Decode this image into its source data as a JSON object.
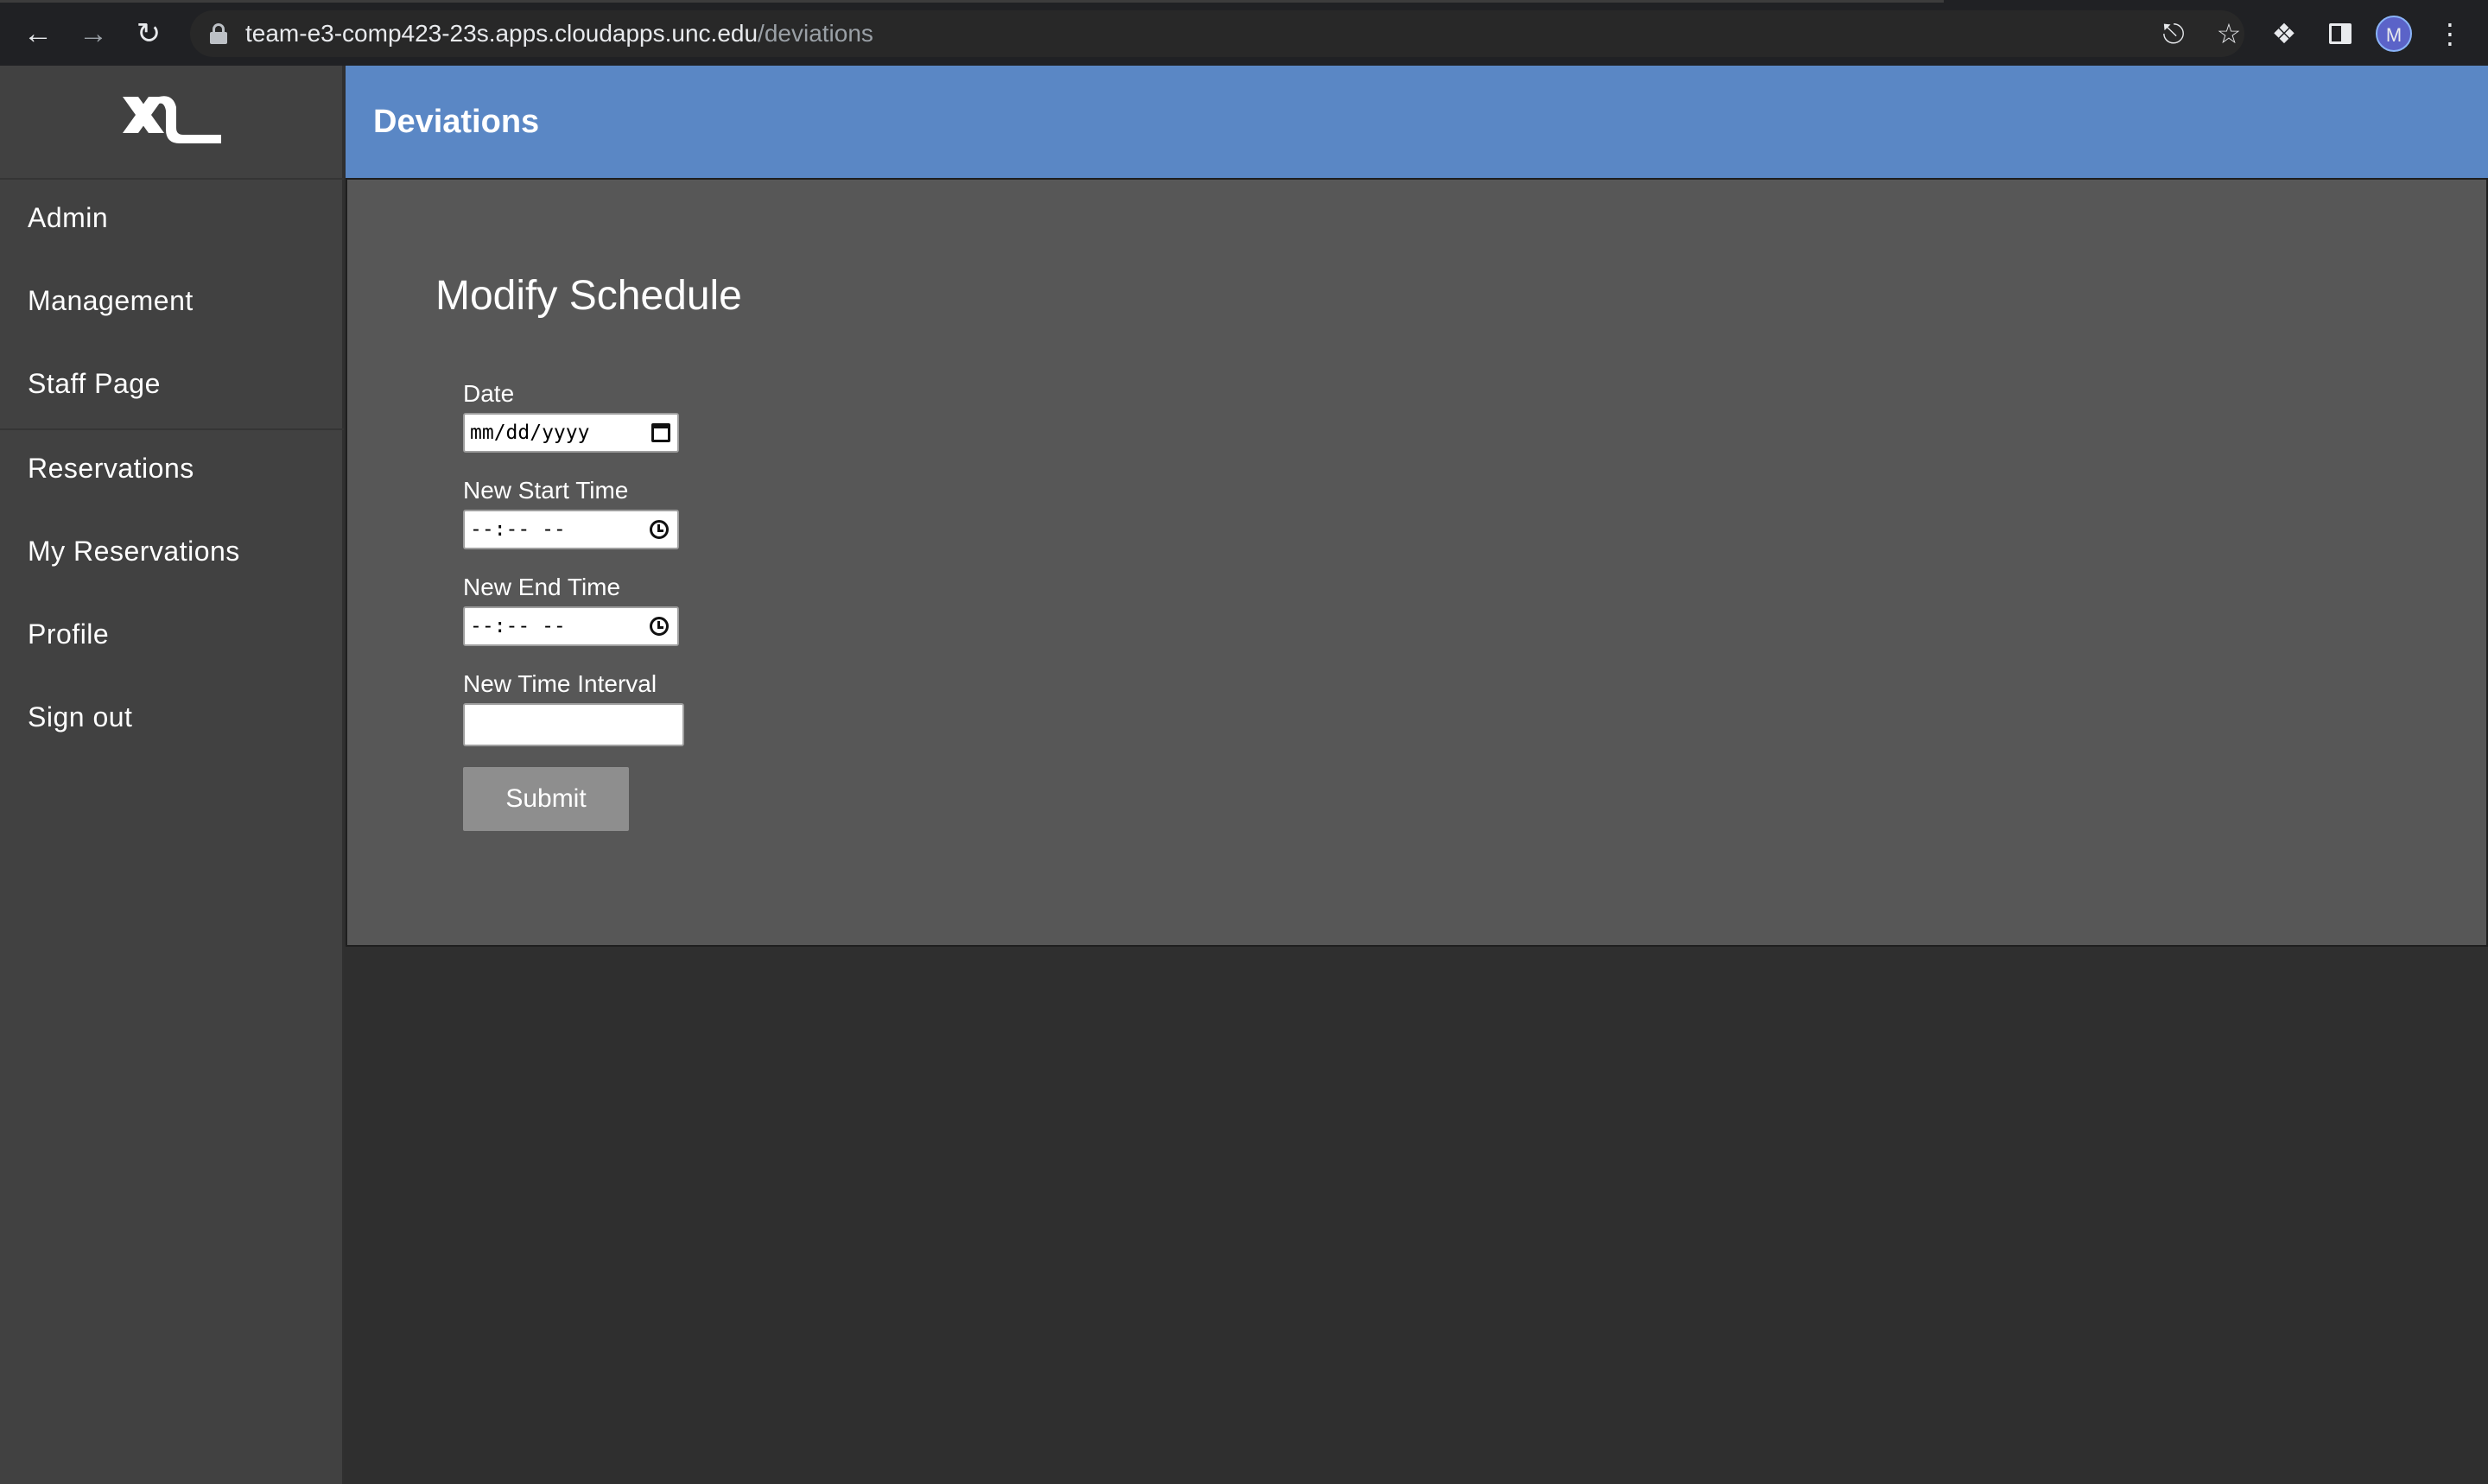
{
  "browser": {
    "url_host": "team-e3-comp423-23s.apps.cloudapps.unc.edu",
    "url_path": "/deviations",
    "profile_initial": "M",
    "icons": {
      "back": "arrow-left-icon",
      "forward": "arrow-right-icon",
      "reload": "reload-icon",
      "lock": "lock-icon",
      "share": "share-icon",
      "bookmark": "star-icon",
      "extensions": "puzzle-icon",
      "side_panel": "side-panel-icon",
      "menu": "kebab-menu-icon"
    }
  },
  "sidebar": {
    "logo_icon": "xl-logo",
    "items": [
      {
        "label": "Admin"
      },
      {
        "label": "Management"
      },
      {
        "label": "Staff Page"
      },
      {
        "label": "Reservations"
      },
      {
        "label": "My Reservations"
      },
      {
        "label": "Profile"
      },
      {
        "label": "Sign out"
      }
    ]
  },
  "header": {
    "title": "Deviations"
  },
  "form": {
    "title": "Modify Schedule",
    "date": {
      "label": "Date",
      "value": "mm/dd/yyyy"
    },
    "start_time": {
      "label": "New Start Time",
      "value": "--:-- --"
    },
    "end_time": {
      "label": "New End Time",
      "value": "--:-- --"
    },
    "interval": {
      "label": "New Time Interval",
      "value": ""
    },
    "submit_label": "Submit"
  },
  "colors": {
    "header_bg": "#5a87c5",
    "sidebar_bg": "#414141",
    "panel_bg": "#575757",
    "page_bg": "#2f2f2f",
    "button_bg": "#8e8e8e"
  }
}
